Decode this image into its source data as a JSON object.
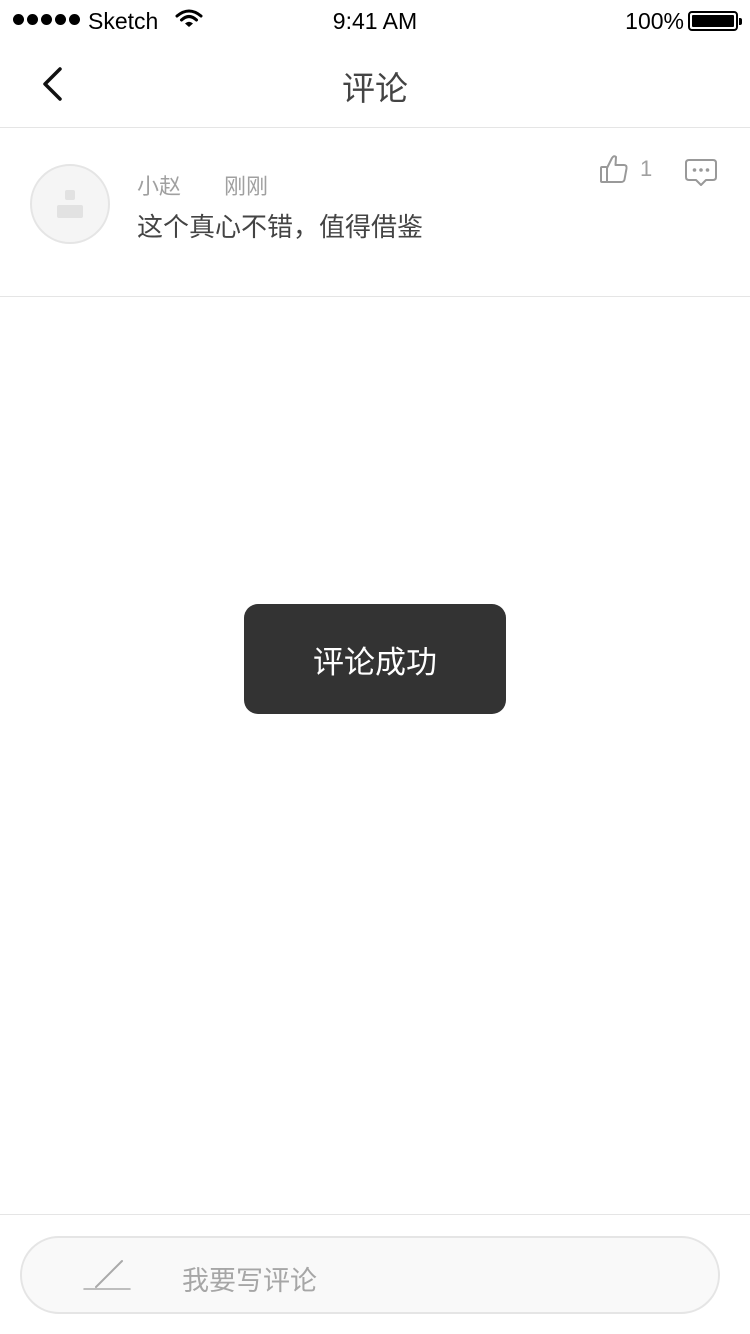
{
  "status_bar": {
    "carrier": "Sketch",
    "time": "9:41 AM",
    "battery": "100%"
  },
  "nav": {
    "title": "评论",
    "back_icon": "chevron-left-icon"
  },
  "comments": [
    {
      "author": "小赵",
      "time": "刚刚",
      "text": "这个真心不错，值得借鉴",
      "likes": "1",
      "like_icon": "thumbs-up-icon",
      "reply_icon": "speech-bubble-icon"
    }
  ],
  "toast": {
    "text": "评论成功"
  },
  "bottom": {
    "placeholder": "我要写评论",
    "icon": "pen-icon"
  },
  "colors": {
    "toast_bg": "#333333",
    "secondary_text": "#a0a0a0",
    "divider": "#e5e5e5"
  }
}
